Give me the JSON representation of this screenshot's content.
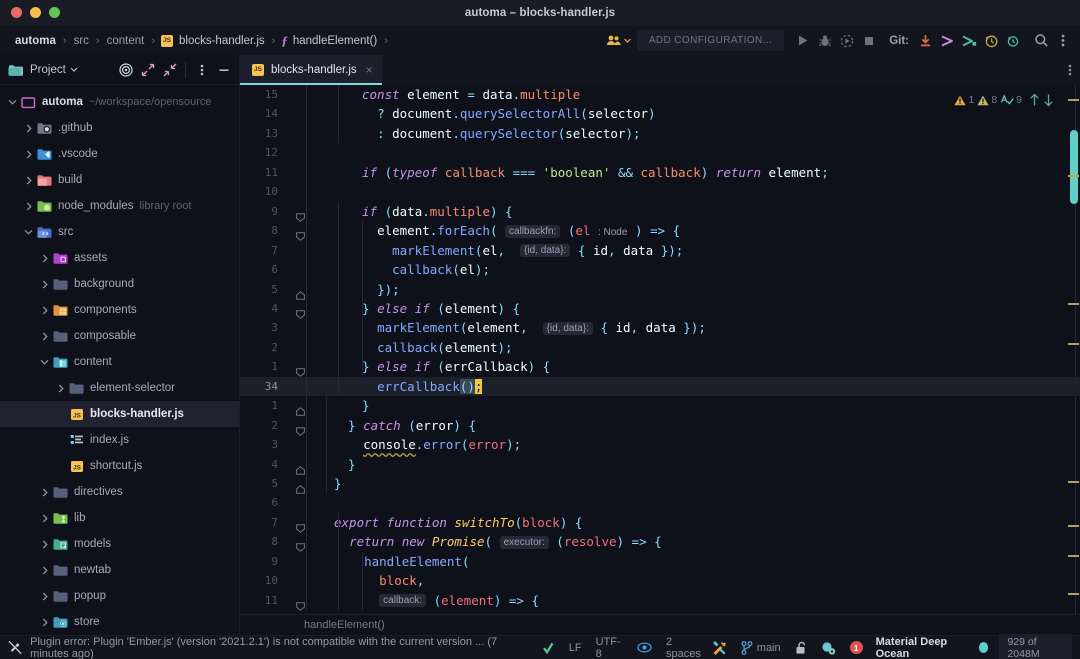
{
  "window": {
    "title": "automa – blocks-handler.js",
    "traffic_lights": [
      "close",
      "minimize",
      "maximize"
    ]
  },
  "breadcrumb": {
    "items": [
      {
        "label": "automa",
        "type": "project"
      },
      {
        "label": "src",
        "type": "folder"
      },
      {
        "label": "content",
        "type": "folder"
      },
      {
        "label": "blocks-handler.js",
        "type": "file",
        "icon": "js-file-icon"
      },
      {
        "label": "handleElement()",
        "type": "function",
        "icon": "function-icon"
      }
    ],
    "separator": "›"
  },
  "toolbar": {
    "run_configuration": "ADD CONFIGURATION...",
    "git_label": "Git:",
    "buttons": [
      {
        "name": "share-project-button",
        "icon": "people-icon"
      },
      {
        "name": "run-button",
        "icon": "play-icon"
      },
      {
        "name": "debug-button",
        "icon": "bug-icon"
      },
      {
        "name": "run-coverage-button",
        "icon": "coverage-icon"
      },
      {
        "name": "stop-button",
        "icon": "stop-icon"
      },
      {
        "name": "git-update-button",
        "icon": "download-arrow-icon"
      },
      {
        "name": "git-commit-button",
        "icon": "commit-arrow-icon"
      },
      {
        "name": "git-push-button",
        "icon": "push-arrow-icon"
      },
      {
        "name": "git-history-button",
        "icon": "history-clock-icon"
      },
      {
        "name": "git-rollback-button",
        "icon": "rollback-icon"
      },
      {
        "name": "search-everywhere-button",
        "icon": "search-icon"
      },
      {
        "name": "more-options-button",
        "icon": "vertical-dots-icon"
      }
    ]
  },
  "sidebar": {
    "panel_title": "Project",
    "header_icons": [
      {
        "name": "select-opened-file-icon",
        "icon": "target-icon"
      },
      {
        "name": "expand-all-icon",
        "icon": "expand-arrows-icon"
      },
      {
        "name": "collapse-all-icon",
        "icon": "collapse-arrows-icon"
      },
      {
        "name": "panel-options-icon",
        "icon": "vertical-dots-icon"
      },
      {
        "name": "hide-panel-icon",
        "icon": "minimize-icon"
      }
    ],
    "tree": [
      {
        "label": "automa",
        "hint": "~/workspace/opensource",
        "depth": 0,
        "expanded": true,
        "icon": "project-root-icon",
        "bold": true,
        "selected": false
      },
      {
        "label": ".github",
        "hint": "",
        "depth": 1,
        "expanded": false,
        "icon": "github-folder-icon",
        "bold": false,
        "selected": false
      },
      {
        "label": ".vscode",
        "hint": "",
        "depth": 1,
        "expanded": false,
        "icon": "vscode-folder-icon",
        "bold": false,
        "selected": false
      },
      {
        "label": "build",
        "hint": "",
        "depth": 1,
        "expanded": false,
        "icon": "build-folder-icon",
        "bold": false,
        "selected": false
      },
      {
        "label": "node_modules",
        "hint": "library root",
        "depth": 1,
        "expanded": false,
        "icon": "node-folder-icon",
        "bold": false,
        "selected": false
      },
      {
        "label": "src",
        "hint": "",
        "depth": 1,
        "expanded": true,
        "icon": "source-folder-icon",
        "bold": false,
        "selected": false
      },
      {
        "label": "assets",
        "hint": "",
        "depth": 2,
        "expanded": false,
        "icon": "assets-folder-icon",
        "bold": false,
        "selected": false
      },
      {
        "label": "background",
        "hint": "",
        "depth": 2,
        "expanded": false,
        "icon": "folder-icon",
        "bold": false,
        "selected": false
      },
      {
        "label": "components",
        "hint": "",
        "depth": 2,
        "expanded": false,
        "icon": "components-folder-icon",
        "bold": false,
        "selected": false
      },
      {
        "label": "composable",
        "hint": "",
        "depth": 2,
        "expanded": false,
        "icon": "folder-icon",
        "bold": false,
        "selected": false
      },
      {
        "label": "content",
        "hint": "",
        "depth": 2,
        "expanded": true,
        "icon": "content-folder-icon",
        "bold": false,
        "selected": false
      },
      {
        "label": "element-selector",
        "hint": "",
        "depth": 3,
        "expanded": false,
        "icon": "folder-icon",
        "bold": false,
        "selected": false
      },
      {
        "label": "blocks-handler.js",
        "hint": "",
        "depth": 3,
        "expanded": null,
        "icon": "js-file-icon",
        "bold": true,
        "selected": true
      },
      {
        "label": "index.js",
        "hint": "",
        "depth": 3,
        "expanded": null,
        "icon": "index-file-icon",
        "bold": false,
        "selected": false
      },
      {
        "label": "shortcut.js",
        "hint": "",
        "depth": 3,
        "expanded": null,
        "icon": "js-file-icon",
        "bold": false,
        "selected": false
      },
      {
        "label": "directives",
        "hint": "",
        "depth": 2,
        "expanded": false,
        "icon": "folder-icon",
        "bold": false,
        "selected": false
      },
      {
        "label": "lib",
        "hint": "",
        "depth": 2,
        "expanded": false,
        "icon": "lib-folder-icon",
        "bold": false,
        "selected": false
      },
      {
        "label": "models",
        "hint": "",
        "depth": 2,
        "expanded": false,
        "icon": "models-folder-icon",
        "bold": false,
        "selected": false
      },
      {
        "label": "newtab",
        "hint": "",
        "depth": 2,
        "expanded": false,
        "icon": "folder-icon",
        "bold": false,
        "selected": false
      },
      {
        "label": "popup",
        "hint": "",
        "depth": 2,
        "expanded": false,
        "icon": "folder-icon",
        "bold": false,
        "selected": false
      },
      {
        "label": "store",
        "hint": "",
        "depth": 2,
        "expanded": false,
        "icon": "store-folder-icon",
        "bold": false,
        "selected": false
      }
    ]
  },
  "editor": {
    "tabs": [
      {
        "label": "blocks-handler.js",
        "icon": "js-file-icon",
        "active": true,
        "close": "×"
      }
    ],
    "inspections": [
      {
        "name": "error-count",
        "value": "1",
        "icon": "warning-triangle-orange"
      },
      {
        "name": "warning-count",
        "value": "8",
        "icon": "warning-triangle-yellow"
      },
      {
        "name": "typo-count",
        "value": "9",
        "icon": "spellcheck-icon"
      },
      {
        "name": "previous-problem",
        "value": "",
        "icon": "arrow-up-icon"
      },
      {
        "name": "next-problem",
        "value": "",
        "icon": "arrow-down-icon"
      }
    ],
    "breadcrumb_bottom": "handleElement()",
    "lines": [
      {
        "num": "15",
        "current": false,
        "indent": 1,
        "fold": null
      },
      {
        "num": "14",
        "current": false,
        "indent": 2,
        "fold": null
      },
      {
        "num": "13",
        "current": false,
        "indent": 2,
        "fold": null
      },
      {
        "num": "12",
        "current": false,
        "indent": 0,
        "fold": null
      },
      {
        "num": "11",
        "current": false,
        "indent": 1,
        "fold": null
      },
      {
        "num": "10",
        "current": false,
        "indent": 0,
        "fold": null
      },
      {
        "num": "9",
        "current": false,
        "indent": 1,
        "fold": "open"
      },
      {
        "num": "8",
        "current": false,
        "indent": 2,
        "fold": "open"
      },
      {
        "num": "7",
        "current": false,
        "indent": 3,
        "fold": null
      },
      {
        "num": "6",
        "current": false,
        "indent": 3,
        "fold": null
      },
      {
        "num": "5",
        "current": false,
        "indent": 2,
        "fold": "close"
      },
      {
        "num": "4",
        "current": false,
        "indent": 1,
        "fold": "open"
      },
      {
        "num": "3",
        "current": false,
        "indent": 2,
        "fold": null
      },
      {
        "num": "2",
        "current": false,
        "indent": 2,
        "fold": null
      },
      {
        "num": "1",
        "current": false,
        "indent": 1,
        "fold": "open"
      },
      {
        "num": "34",
        "current": true,
        "indent": 2,
        "fold": null
      },
      {
        "num": "1",
        "current": false,
        "indent": 1,
        "fold": "close"
      },
      {
        "num": "2",
        "current": false,
        "indent": 1,
        "fold": "open"
      },
      {
        "num": "3",
        "current": false,
        "indent": 2,
        "fold": null
      },
      {
        "num": "4",
        "current": false,
        "indent": 1,
        "fold": "close"
      },
      {
        "num": "5",
        "current": false,
        "indent": 0,
        "fold": "close"
      },
      {
        "num": "6",
        "current": false,
        "indent": 0,
        "fold": null
      },
      {
        "num": "7",
        "current": false,
        "indent": 0,
        "fold": "open"
      },
      {
        "num": "8",
        "current": false,
        "indent": 1,
        "fold": "open"
      },
      {
        "num": "9",
        "current": false,
        "indent": 2,
        "fold": null
      },
      {
        "num": "10",
        "current": false,
        "indent": 3,
        "fold": null
      },
      {
        "num": "11",
        "current": false,
        "indent": 3,
        "fold": "open"
      }
    ],
    "code_text": [
      "const element = data.multiple",
      "? document.querySelectorAll(selector)",
      ": document.querySelector(selector);",
      "",
      "if (typeof callback === 'boolean' && callback) return element;",
      "",
      "if (data.multiple) {",
      "element.forEach( callbackfn: (el : Node ) => {",
      "markElement(el,  {id, data}: { id, data });",
      "callback(el);",
      "});",
      "} else if (element) {",
      "markElement(element,  {id, data}: { id, data });",
      "callback(element);",
      "} else if (errCallback) {",
      "errCallback();",
      "}",
      "} catch (error) {",
      "console.error(error);",
      "}",
      "}",
      "",
      "export function switchTo(block) {",
      "return new Promise( executor: (resolve) => {",
      "handleElement(",
      "block,",
      "callback: (element) => {"
    ]
  },
  "statusbar": {
    "message": "Plugin error: Plugin 'Ember.js' (version '2021.2.1') is not compatible with the current version ... (7 minutes ago)",
    "message_icon": "plugin-error-icon",
    "items": [
      {
        "name": "inspection-widget",
        "label": "",
        "icon": "checkmark-green-icon"
      },
      {
        "name": "line-separator",
        "label": "LF",
        "icon": ""
      },
      {
        "name": "file-encoding",
        "label": "UTF-8",
        "icon": ""
      },
      {
        "name": "reader-mode",
        "label": "",
        "icon": "eye-icon"
      },
      {
        "name": "indent-size",
        "label": "2 spaces",
        "icon": ""
      },
      {
        "name": "code-style-config",
        "label": "",
        "icon": "tools-icon"
      },
      {
        "name": "git-branch",
        "label": "main",
        "icon": "branch-icon"
      },
      {
        "name": "lock-status",
        "label": "",
        "icon": "unlocked-padlock-icon"
      },
      {
        "name": "event-log",
        "label": "",
        "icon": "event-log-icon"
      },
      {
        "name": "notification-count",
        "label": "1",
        "icon": "red-badge-icon"
      },
      {
        "name": "theme-switcher",
        "label": "Material Deep Ocean",
        "icon": ""
      },
      {
        "name": "theme-color-indicator",
        "label": "",
        "icon": "cyan-dot-icon"
      },
      {
        "name": "memory-indicator",
        "label": "929 of 2048M",
        "icon": ""
      }
    ]
  },
  "colors": {
    "background": "#0f111a",
    "panel": "#13151e",
    "accent_cyan": "#5fd0c8",
    "selection": "#20232f",
    "keyword": "#c792ea",
    "string": "#c3e88d",
    "function": "#82aaff",
    "property": "#f78c6c",
    "operator": "#89ddff",
    "warning": "#c5a44a"
  }
}
